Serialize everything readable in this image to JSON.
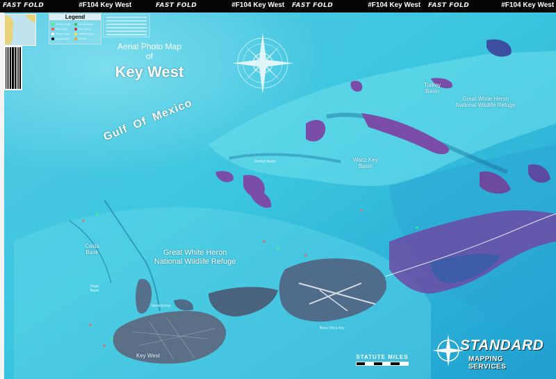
{
  "banner": {
    "groups": [
      {
        "brand": "FAST FOLD",
        "map_id": "#F104 Key West"
      },
      {
        "brand": "FAST FOLD",
        "map_id": "#F104 Key West"
      },
      {
        "brand": "FAST FOLD",
        "map_id": "#F104 Key West"
      },
      {
        "brand": "FAST FOLD",
        "map_id": "#F104 Key West"
      }
    ]
  },
  "legend": {
    "title": "Legend",
    "items": [
      "Green Light",
      "Green Buoy",
      "Red Light",
      "Red Buoy",
      "White Light",
      "Yellow Buoy",
      "Daymarker",
      "Wreck"
    ]
  },
  "titles": {
    "aerial_line1": "Aerial Photo Map",
    "aerial_line2": "of",
    "main": "Key West"
  },
  "places": {
    "gulf_words": [
      "Gulf",
      "Of",
      "Mexico"
    ],
    "turkey_basin_1": "Turkey",
    "turkey_basin_2": "Basin",
    "gwh_ne_1": "Great White Heron",
    "gwh_ne_2": "National Wildlife Refuge",
    "waltz_1": "Waltz Key",
    "waltz_2": "Basin",
    "calda_1": "Calda",
    "calda_2": "Bank",
    "gwh_1": "Great White Heron",
    "gwh_2": "National Wildlife Refuge",
    "key_west": "Key West",
    "pearl_basin_1": "Pearl",
    "pearl_basin_2": "Basin",
    "jewfish_basin": "Jewfish Basin",
    "boca_chica": "Boca Chica Key",
    "fleming_key": "Fleming Key"
  },
  "scale": {
    "title": "STATUTE MILES"
  },
  "logo": {
    "line1": "STANDARD",
    "line2": "MAPPING SERVICES"
  },
  "colors": {
    "sea_shallow": "#3fd3e6",
    "sea_deep": "#1d8fc2",
    "land_purple": "#7a4ea8",
    "land_dark": "#2f4b6c",
    "gulf_light": "#9fe8f2"
  }
}
